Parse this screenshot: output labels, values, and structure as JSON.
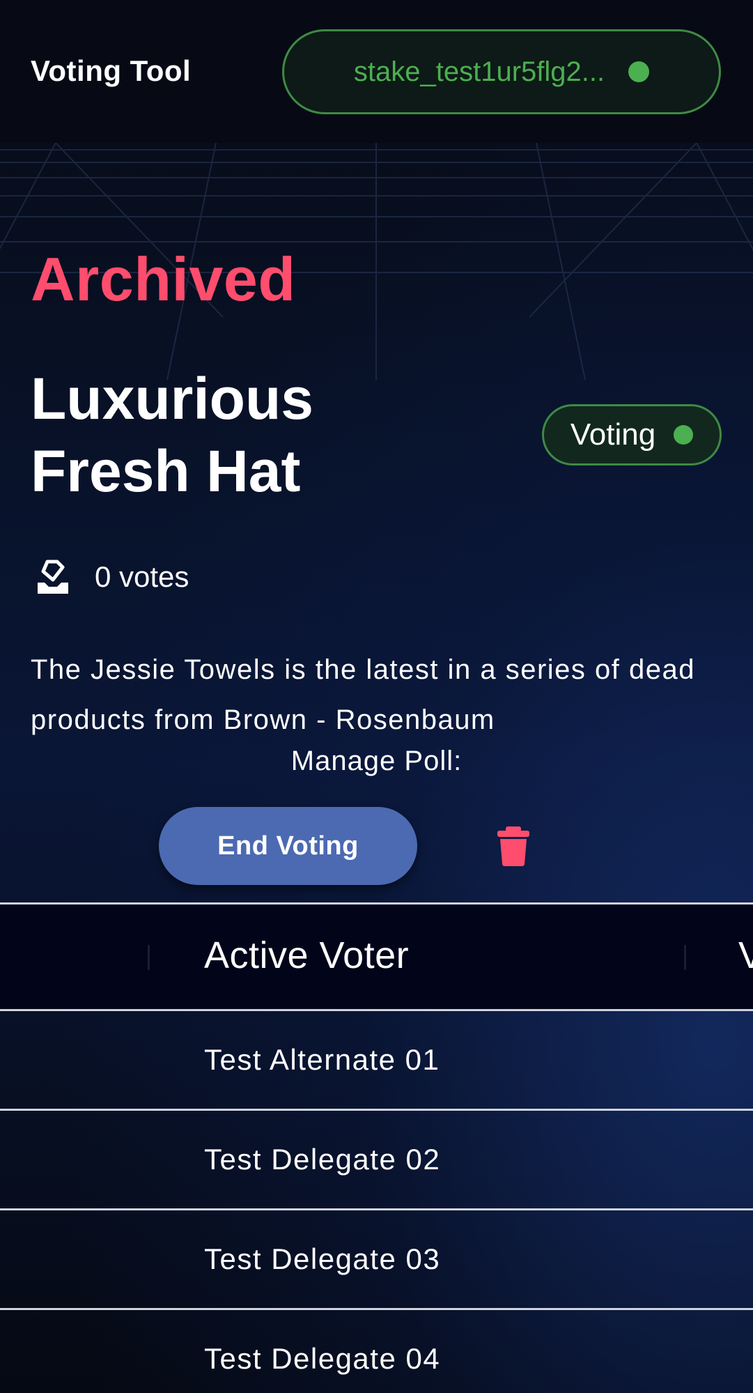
{
  "app": {
    "title": "Voting Tool",
    "wallet_address": "stake_test1ur5flg2...",
    "wallet_connected_color": "#4caf50"
  },
  "poll": {
    "state_label": "Archived",
    "title": "Luxurious Fresh Hat",
    "status": "Voting",
    "votes": "0 votes",
    "description": "The Jessie Towels is the latest in a series of dead products from Brown - Rosenbaum",
    "manage_label": "Manage Poll:",
    "end_voting_label": "End Voting",
    "delete_icon": "trash-icon",
    "votes_icon": "ballot-icon"
  },
  "table": {
    "columns": [
      "Active Voter",
      "V"
    ],
    "rows": [
      {
        "voter": "Test Alternate 01"
      },
      {
        "voter": "Test Delegate 02"
      },
      {
        "voter": "Test Delegate 03"
      },
      {
        "voter": "Test Delegate 04"
      }
    ]
  },
  "colors": {
    "archived": "#ff4d6d",
    "accent_green": "#4caf50",
    "button_blue": "#4c6ab2",
    "background": "#070b15"
  }
}
